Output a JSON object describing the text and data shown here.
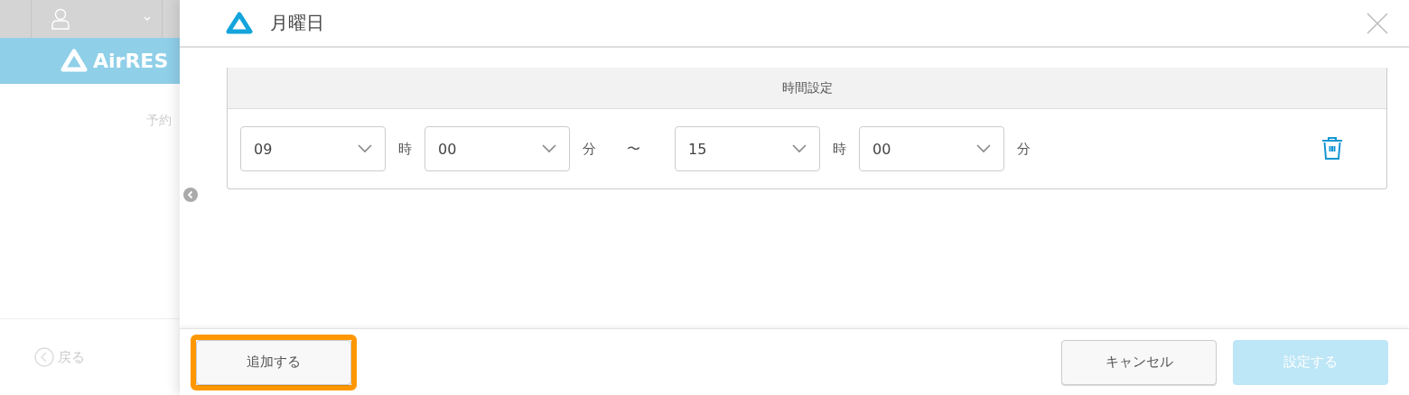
{
  "background": {
    "logo": "AirRES",
    "heading": "予約",
    "back_link": "戻る"
  },
  "dialog": {
    "title": "月曜日",
    "table": {
      "header": "時間設定",
      "rows": [
        {
          "parts": [
            {
              "kind": "select",
              "value": "09"
            },
            {
              "kind": "unit",
              "text": "時"
            },
            {
              "kind": "select",
              "value": "00"
            },
            {
              "kind": "unit",
              "text": "分"
            },
            {
              "kind": "separator",
              "text": "〜"
            },
            {
              "kind": "select",
              "value": "15"
            },
            {
              "kind": "unit",
              "text": "時"
            },
            {
              "kind": "select",
              "value": "00"
            },
            {
              "kind": "unit",
              "text": "分"
            }
          ]
        }
      ]
    }
  },
  "footer": {
    "add_button": {
      "label": "追加する",
      "highlighted": true
    },
    "cancel_button": {
      "label": "キャンセル"
    },
    "submit_button": {
      "label": "設定する",
      "disabled": true
    }
  }
}
